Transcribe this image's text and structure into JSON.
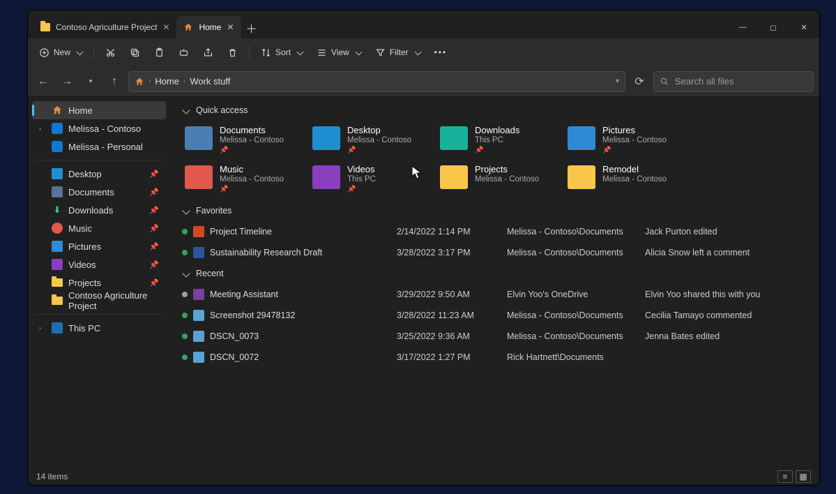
{
  "tabs": [
    {
      "label": "Contoso Agriculture Project",
      "active": false
    },
    {
      "label": "Home",
      "active": true
    }
  ],
  "toolbar": {
    "new": "New",
    "sort": "Sort",
    "view": "View",
    "filter": "Filter"
  },
  "breadcrumb": {
    "seg1": "Home",
    "seg2": "Work stuff"
  },
  "search": {
    "placeholder": "Search all files"
  },
  "sidebar": {
    "home": "Home",
    "acct1": "Melissa - Contoso",
    "acct2": "Melissa - Personal",
    "desktop": "Desktop",
    "documents": "Documents",
    "downloads": "Downloads",
    "music": "Music",
    "pictures": "Pictures",
    "videos": "Videos",
    "projects": "Projects",
    "capfolder": "Contoso Agriculture Project",
    "thispc": "This PC"
  },
  "sections": {
    "quick": "Quick access",
    "fav": "Favorites",
    "recent": "Recent"
  },
  "quick": [
    {
      "name": "Documents",
      "sub": "Melissa - Contoso",
      "thumb": "#4a7fb3",
      "status": "#36a35e"
    },
    {
      "name": "Desktop",
      "sub": "Melissa - Contoso",
      "thumb": "#1e90d2",
      "status": ""
    },
    {
      "name": "Downloads",
      "sub": "This PC",
      "thumb": "#17b29a",
      "status": ""
    },
    {
      "name": "Pictures",
      "sub": "Melissa - Contoso",
      "thumb": "#2f8ad6",
      "status": "#9aa0a6"
    },
    {
      "name": "Music",
      "sub": "Melissa - Contoso",
      "thumb": "#e0584e",
      "status": ""
    },
    {
      "name": "Videos",
      "sub": "This PC",
      "thumb": "#8a3fbf",
      "status": ""
    },
    {
      "name": "Projects",
      "sub": "Melissa - Contoso",
      "thumb": "#f8c64b",
      "status": "#9aa0a6"
    },
    {
      "name": "Remodel",
      "sub": "Melissa - Contoso",
      "thumb": "#f8c64b",
      "status": "#9aa0a6"
    }
  ],
  "favorites": [
    {
      "name": "Project Timeline",
      "date": "2/14/2022 1:14 PM",
      "loc": "Melissa - Contoso\\Documents",
      "act": "Jack Purton edited",
      "icon": "#d24726"
    },
    {
      "name": "Sustainability Research Draft",
      "date": "3/28/2022 3:17 PM",
      "loc": "Melissa - Contoso\\Documents",
      "act": "Alicia Snow left a comment",
      "icon": "#2b579a"
    }
  ],
  "recent": [
    {
      "name": "Meeting Assistant",
      "date": "3/29/2022 9:50 AM",
      "loc": "Elvin Yoo's OneDrive",
      "act": "Elvin Yoo shared this with you",
      "icon": "#7b3fa0",
      "status": "#9aa0a6"
    },
    {
      "name": "Screenshot 29478132",
      "date": "3/28/2022 11:23 AM",
      "loc": "Melissa - Contoso\\Documents",
      "act": "Cecilia Tamayo commented",
      "icon": "#5aa2d6",
      "status": "#36a35e"
    },
    {
      "name": "DSCN_0073",
      "date": "3/25/2022 9:36 AM",
      "loc": "Melissa - Contoso\\Documents",
      "act": "Jenna Bates edited",
      "icon": "#5aa2d6",
      "status": "#36a35e"
    },
    {
      "name": "DSCN_0072",
      "date": "3/17/2022 1:27 PM",
      "loc": "Rick Hartnett\\Documents",
      "act": "",
      "icon": "#5aa2d6",
      "status": "#36a35e"
    }
  ],
  "status": {
    "count": "14 items"
  }
}
